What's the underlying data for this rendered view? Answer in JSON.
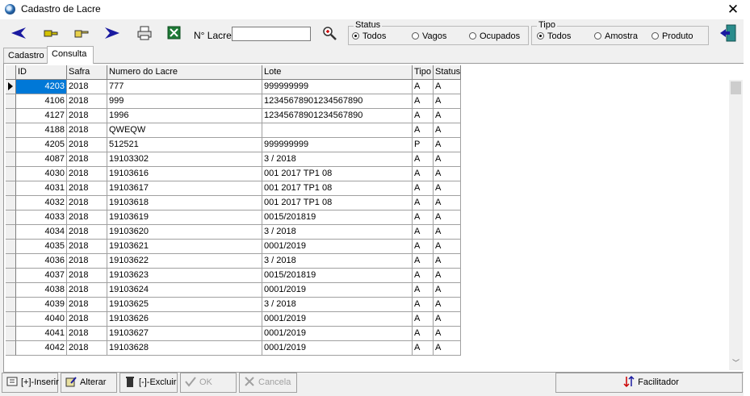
{
  "window": {
    "title": "Cadastro de Lacre",
    "close_glyph": "✕"
  },
  "toolbar": {
    "lacre_label": "N° Lacre",
    "lacre_value": "",
    "icons": [
      "nav-prev-icon",
      "key-icon",
      "hand-icon",
      "nav-next-icon",
      "printer-icon",
      "excel-icon",
      "search-zoom-icon",
      "exit-door-icon"
    ]
  },
  "status_group": {
    "legend": "Status",
    "options": [
      {
        "label": "Todos",
        "selected": true
      },
      {
        "label": "Vagos",
        "selected": false
      },
      {
        "label": "Ocupados",
        "selected": false
      }
    ]
  },
  "tipo_group": {
    "legend": "Tipo",
    "options": [
      {
        "label": "Todos",
        "selected": true
      },
      {
        "label": "Amostra",
        "selected": false
      },
      {
        "label": "Produto",
        "selected": false
      }
    ]
  },
  "tabs": [
    {
      "label": "Cadastro",
      "active": false
    },
    {
      "label": "Consulta",
      "active": true
    }
  ],
  "grid": {
    "columns": [
      "ID",
      "Safra",
      "Numero do Lacre",
      "Lote",
      "Tipo",
      "Status"
    ],
    "rows": [
      [
        "4203",
        "2018",
        "777",
        "999999999",
        "A",
        "A"
      ],
      [
        "4106",
        "2018",
        "999",
        "12345678901234567890",
        "A",
        "A"
      ],
      [
        "4127",
        "2018",
        "1996",
        "12345678901234567890",
        "A",
        "A"
      ],
      [
        "4188",
        "2018",
        "QWEQW",
        "",
        "A",
        "A"
      ],
      [
        "4205",
        "2018",
        "512521",
        "999999999",
        "P",
        "A"
      ],
      [
        "4087",
        "2018",
        "19103302",
        "3 / 2018",
        "A",
        "A"
      ],
      [
        "4030",
        "2018",
        "19103616",
        "001 2017 TP1 08",
        "A",
        "A"
      ],
      [
        "4031",
        "2018",
        "19103617",
        "001 2017 TP1 08",
        "A",
        "A"
      ],
      [
        "4032",
        "2018",
        "19103618",
        "001 2017 TP1 08",
        "A",
        "A"
      ],
      [
        "4033",
        "2018",
        "19103619",
        "0015/201819",
        "A",
        "A"
      ],
      [
        "4034",
        "2018",
        "19103620",
        "3 / 2018",
        "A",
        "A"
      ],
      [
        "4035",
        "2018",
        "19103621",
        "0001/2019",
        "A",
        "A"
      ],
      [
        "4036",
        "2018",
        "19103622",
        "3 / 2018",
        "A",
        "A"
      ],
      [
        "4037",
        "2018",
        "19103623",
        "0015/201819",
        "A",
        "A"
      ],
      [
        "4038",
        "2018",
        "19103624",
        "0001/2019",
        "A",
        "A"
      ],
      [
        "4039",
        "2018",
        "19103625",
        "3 / 2018",
        "A",
        "A"
      ],
      [
        "4040",
        "2018",
        "19103626",
        "0001/2019",
        "A",
        "A"
      ],
      [
        "4041",
        "2018",
        "19103627",
        "0001/2019",
        "A",
        "A"
      ],
      [
        "4042",
        "2018",
        "19103628",
        "0001/2019",
        "A",
        "A"
      ]
    ]
  },
  "buttons": {
    "inserir": "[+]-Inserir",
    "alterar": "Alterar",
    "excluir": "[-]-Excluir",
    "ok": "OK",
    "cancela": "Cancela",
    "facilitador": "Facilitador"
  },
  "colors": {
    "selection": "#0078d7",
    "nav_arrow": "#1a1aa0"
  }
}
